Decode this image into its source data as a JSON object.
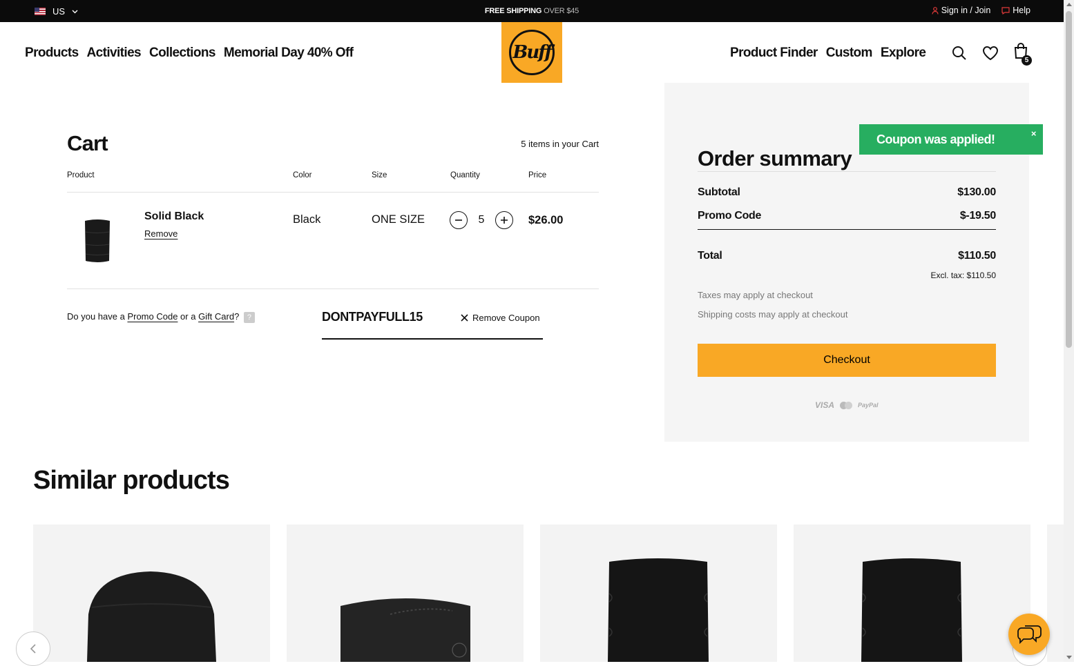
{
  "topbar": {
    "locale": "US",
    "shipping_bold": "FREE SHIPPING",
    "shipping_rest": " OVER $45",
    "sign_in": "Sign in / Join",
    "help": "Help"
  },
  "nav": {
    "left": [
      "Products",
      "Activities",
      "Collections",
      "Memorial Day 40% Off"
    ],
    "right": [
      "Product Finder",
      "Custom",
      "Explore"
    ],
    "logo_text": "Buff",
    "bag_count": "5"
  },
  "cart": {
    "title": "Cart",
    "items_count": "5 items in your Cart",
    "headers": {
      "product": "Product",
      "color": "Color",
      "size": "Size",
      "quantity": "Quantity",
      "price": "Price"
    },
    "item": {
      "name": "Solid Black",
      "remove": "Remove",
      "color": "Black",
      "size": "ONE SIZE",
      "quantity": "5",
      "price": "$26.00"
    },
    "promo": {
      "text_1": "Do you have a ",
      "promo_link": "Promo Code",
      "text_2": " or a ",
      "gift_link": "Gift Card",
      "text_3": "?",
      "help": "?",
      "code": "DONTPAYFULL15",
      "remove_coupon": "Remove Coupon"
    }
  },
  "summary": {
    "title": "Order summary",
    "subtotal_label": "Subtotal",
    "subtotal_value": "$130.00",
    "promo_label": "Promo Code",
    "promo_value": "$-19.50",
    "total_label": "Total",
    "total_value": "$110.50",
    "excl_tax": "Excl. tax: $110.50",
    "taxes_note": "Taxes may apply at checkout",
    "shipping_note": "Shipping costs may apply at checkout",
    "checkout": "Checkout",
    "pay_visa": "VISA",
    "pay_paypal": "PayPal"
  },
  "toast": {
    "message": "Coupon was applied!",
    "close": "×"
  },
  "similar": {
    "title": "Similar products"
  },
  "colors": {
    "brand_yellow": "#f9a825",
    "toast_green": "#27ae60"
  }
}
